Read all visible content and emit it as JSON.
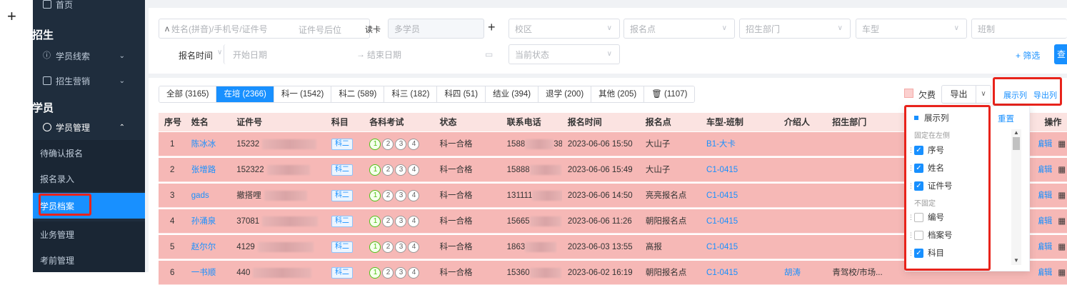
{
  "outer_plus": "+",
  "sidebar": {
    "top_cut": "首页",
    "group1": "招生",
    "item_leads": "学员线索",
    "item_marketing": "招生营销",
    "group2": "学员",
    "item_student_mgmt": "学员管理",
    "subs": [
      "待确认报名",
      "报名录入",
      "学员档案",
      "业务管理",
      "考前管理"
    ]
  },
  "filters": {
    "search_placeholder": "姓名(拼音)/手机号/证件号",
    "id_suffix_placeholder": "证件号后位",
    "read_card": "读卡",
    "multi_student": "多学员",
    "add": "+",
    "campus": "校区",
    "enroll_point": "报名点",
    "recruit_dept": "招生部门",
    "car_type": "车型",
    "class_type": "班制",
    "enroll_time": "报名时间",
    "start_date": "开始日期",
    "range_sep": "→",
    "end_date": "结束日期",
    "current_status": "当前状态",
    "filter_btn": "+ 筛选",
    "query_btn": "查"
  },
  "tabs": [
    {
      "label": "全部 (3165)",
      "active": false
    },
    {
      "label": "在培 (2366)",
      "active": true
    },
    {
      "label": "科一 (1542)",
      "active": false
    },
    {
      "label": "科二 (589)",
      "active": false
    },
    {
      "label": "科三 (182)",
      "active": false
    },
    {
      "label": "科四 (51)",
      "active": false
    },
    {
      "label": "结业 (394)",
      "active": false
    },
    {
      "label": "退学 (200)",
      "active": false
    },
    {
      "label": "其他 (205)",
      "active": false
    },
    {
      "label": "(1107)",
      "active": false
    }
  ],
  "toolbar": {
    "arrears": "欠费",
    "export": "导出",
    "show_columns": "展示列",
    "export_columns": "导出列"
  },
  "table": {
    "headers": [
      "序号",
      "姓名",
      "证件号",
      "科目",
      "各科考试",
      "状态",
      "联系电话",
      "报名时间",
      "报名点",
      "车型-班制",
      "介绍人",
      "招生部门",
      "操作"
    ],
    "rows": [
      {
        "no": "1",
        "name": "陈冰冰",
        "id": "15232",
        "subject": "科二",
        "status": "科一合格",
        "phone": "1588",
        "phone_tail": "38",
        "time": "2023-06-06 15:50",
        "point": "大山子",
        "car": "B1-大卡",
        "intro": "",
        "dept": ""
      },
      {
        "no": "2",
        "name": "张增路",
        "id": "152322",
        "subject": "科二",
        "status": "科一合格",
        "phone": "15888",
        "phone_tail": "",
        "time": "2023-06-06 15:49",
        "point": "大山子",
        "car": "C1-0415",
        "intro": "",
        "dept": ""
      },
      {
        "no": "3",
        "name": "gads",
        "id": "撤搭哩",
        "subject": "科二",
        "status": "科一合格",
        "phone": "131111",
        "phone_tail": "",
        "time": "2023-06-06 14:50",
        "point": "亮亮报名点",
        "car": "C1-0415",
        "intro": "",
        "dept": ""
      },
      {
        "no": "4",
        "name": "孙涌泉",
        "id": "37081",
        "subject": "科二",
        "status": "科一合格",
        "phone": "15665",
        "phone_tail": "",
        "time": "2023-06-06 11:26",
        "point": "朝阳报名点",
        "car": "C1-0415",
        "intro": "",
        "dept": ""
      },
      {
        "no": "5",
        "name": "赵尔尔",
        "id": "4129",
        "subject": "科二",
        "status": "科一合格",
        "phone": "1863",
        "phone_tail": "",
        "time": "2023-06-03 13:55",
        "point": "高报",
        "car": "C1-0415",
        "intro": "",
        "dept": ""
      },
      {
        "no": "6",
        "name": "一书顺",
        "id": "440",
        "subject": "科二",
        "status": "科一合格",
        "phone": "15360",
        "phone_tail": "",
        "time": "2023-06-02 16:19",
        "point": "朝阳报名点",
        "car": "C1-0415",
        "intro": "胡涛",
        "dept": "青驾校/市场..."
      }
    ],
    "exam_circles": [
      "1",
      "2",
      "3",
      "4"
    ],
    "ops_edit": "编辑"
  },
  "column_panel": {
    "title": "展示列",
    "reset": "重置",
    "fixed_left_caption": "固定在左侧",
    "unfixed_caption": "不固定",
    "fixed_items": [
      {
        "label": "序号",
        "checked": true
      },
      {
        "label": "姓名",
        "checked": true
      },
      {
        "label": "证件号",
        "checked": true
      }
    ],
    "unfixed_items": [
      {
        "label": "编号",
        "checked": false
      },
      {
        "label": "档案号",
        "checked": false
      },
      {
        "label": "科目",
        "checked": true
      }
    ]
  },
  "colors": {
    "primary": "#1890ff",
    "sidebar_bg": "#1f2d3d",
    "row_pink": "#f6b8b6",
    "highlight": "#e8231b"
  }
}
